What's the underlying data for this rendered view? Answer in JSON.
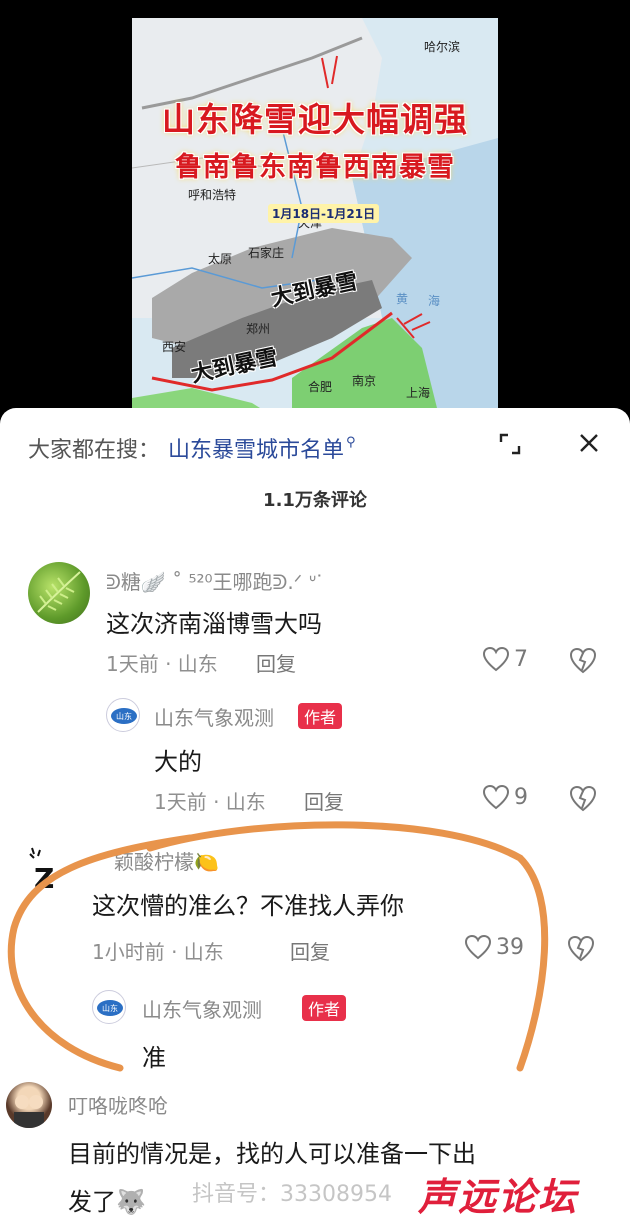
{
  "video": {
    "title_line1": "山东降雪迎大幅调强",
    "title_line2": "鲁南鲁东南鲁西南暴雪",
    "date_range": "1月18日-1月21日",
    "cities": {
      "harbin": "哈尔滨",
      "hohhot": "呼和浩特",
      "tianjin": "天津",
      "taiyuan": "太原",
      "shijiazhuang": "石家庄",
      "zhengzhou": "郑州",
      "xian": "西安",
      "hefei": "合肥",
      "nanjing": "南京",
      "shanghai": "上海",
      "yellow_sea_1": "黄",
      "yellow_sea_2": "海"
    },
    "snow_label_1": "大到暴雪",
    "snow_label_2": "大到暴雪"
  },
  "search": {
    "prefix": "大家都在搜：",
    "term": "山东暴雪城市名单"
  },
  "comment_count": "1.1万条评论",
  "comments": [
    {
      "username": "ᕲ糖🪽 ˚ ⁵²⁰王哪跑ᕲ.ᐟ ᐡᐝ",
      "text": "这次济南淄博雪大吗",
      "meta": "1天前 · 山东",
      "reply": "回复",
      "likes": "7",
      "replies": [
        {
          "username": "山东气象观测",
          "badge": "作者",
          "text": "大的",
          "meta": "1天前 · 山东",
          "reply": "回复",
          "likes": "9"
        }
      ]
    },
    {
      "username": "颖酸柠檬🍋",
      "text": "这次懵的准么？不准找人弄你",
      "meta": "1小时前 · 山东",
      "reply": "回复",
      "likes": "39",
      "replies": [
        {
          "username": "山东气象观测",
          "badge": "作者",
          "text": "准"
        }
      ]
    },
    {
      "username": "叮咯咙咚呛",
      "text_line1": "目前的情况是，找的人可以准备一下出",
      "text_line2": "发了🐺"
    }
  ],
  "watermark": "抖音号：33308954",
  "brand": "声远论坛",
  "colors": {
    "accent_red": "#e8304a",
    "link_blue": "#2b4a9a",
    "circle_orange": "#e8944c"
  }
}
